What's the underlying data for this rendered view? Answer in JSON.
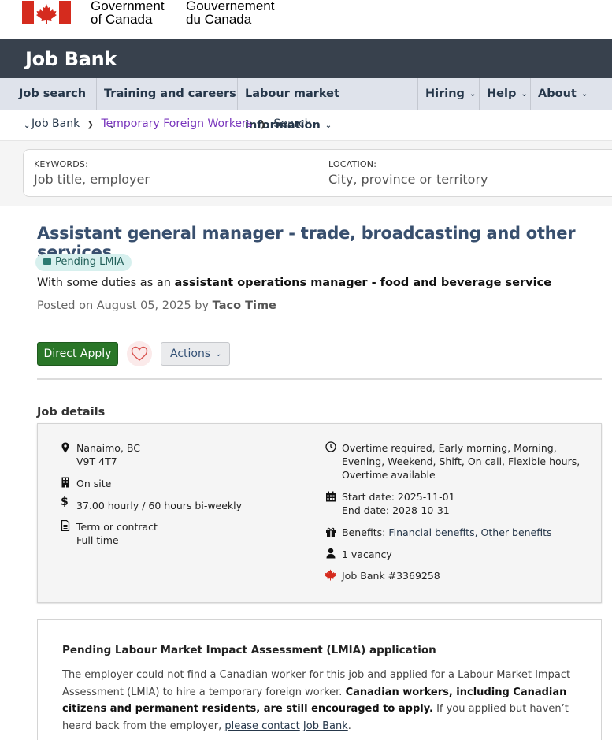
{
  "gc": {
    "english_line1": "Government",
    "english_line2": "of Canada",
    "french_line1": "Gouvernement",
    "french_line2": "du Canada",
    "flag_color": "#d52b1e"
  },
  "app": {
    "title": "Job Bank"
  },
  "nav": {
    "items": [
      {
        "label": "Job search"
      },
      {
        "label": "Training and careers"
      },
      {
        "label": "Labour market information"
      },
      {
        "label": "Hiring"
      },
      {
        "label": "Help"
      },
      {
        "label": "About"
      }
    ]
  },
  "breadcrumb": {
    "items": [
      {
        "label": "Job Bank"
      },
      {
        "label": "Temporary Foreign Workers"
      },
      {
        "label": "Search"
      }
    ]
  },
  "search": {
    "keywords_label": "KEYWORDS:",
    "keywords_placeholder": "Job title, employer",
    "location_label": "LOCATION:",
    "location_placeholder": "City, province or territory"
  },
  "job": {
    "title": "Assistant general manager - trade, broadcasting and other services",
    "badge": "Pending LMIA",
    "duties_prefix": "With some duties as an ",
    "duties_role": "assistant operations manager - food and beverage service",
    "posted_prefix": "Posted on August 05, 2025 by ",
    "employer": "Taco Time",
    "apply_label": "Direct Apply",
    "actions_label": "Actions"
  },
  "details": {
    "heading": "Job details",
    "location_line1": "Nanaimo, BC",
    "location_line2": "V9T 4T7",
    "workplace": "On site",
    "salary": "37.00 hourly / 60 hours bi-weekly",
    "terms_line1": "Term or contract",
    "terms_line2": "Full time",
    "hours_line1": "Overtime required, Early morning, Morning,",
    "hours_line2": "Evening, Weekend, Shift, On call, Flexible hours,",
    "hours_line3": "Overtime available",
    "start_date": "Start date: 2025-11-01",
    "end_date": "End date: 2028-10-31",
    "benefits_prefix": "Benefits: ",
    "benefits_link": "Financial benefits, Other benefits",
    "vacancy": "1 vacancy",
    "job_number": "Job Bank #3369258"
  },
  "lmia": {
    "title": "Pending Labour Market Impact Assessment (LMIA) application",
    "body_1": "The employer could not find a Canadian worker for this job and applied for a Labour Market Impact Assessment (LMIA) to hire a temporary foreign worker. ",
    "body_bold": "Canadian workers, including Canadian citizens and permanent residents, are still encouraged to apply.",
    "body_2": " If you applied but haven’t heard back from the employer, ",
    "contact_link": "please contact",
    "body_3": " ",
    "jobbank_link": "Job Bank",
    "body_end": "."
  }
}
